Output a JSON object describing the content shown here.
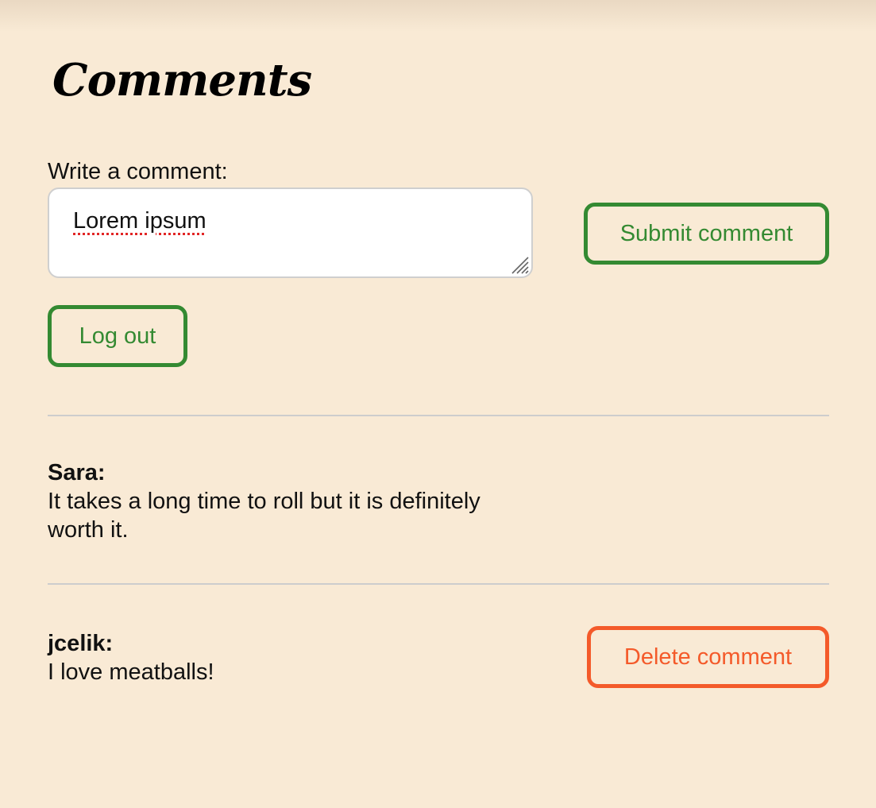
{
  "page": {
    "title": "Comments"
  },
  "form": {
    "label": "Write a comment:",
    "textarea_value": "Lorem ipsum",
    "submit_label": "Submit comment",
    "logout_label": "Log out"
  },
  "comments": [
    {
      "author": "Sara:",
      "text": "It takes a long time to roll but it is definitely worth it."
    },
    {
      "author": "jcelik:",
      "text": "I love meatballs!",
      "delete_label": "Delete comment"
    }
  ],
  "colors": {
    "background": "#f9ead5",
    "primary_green": "#348a32",
    "danger_orange": "#f45a2a"
  }
}
